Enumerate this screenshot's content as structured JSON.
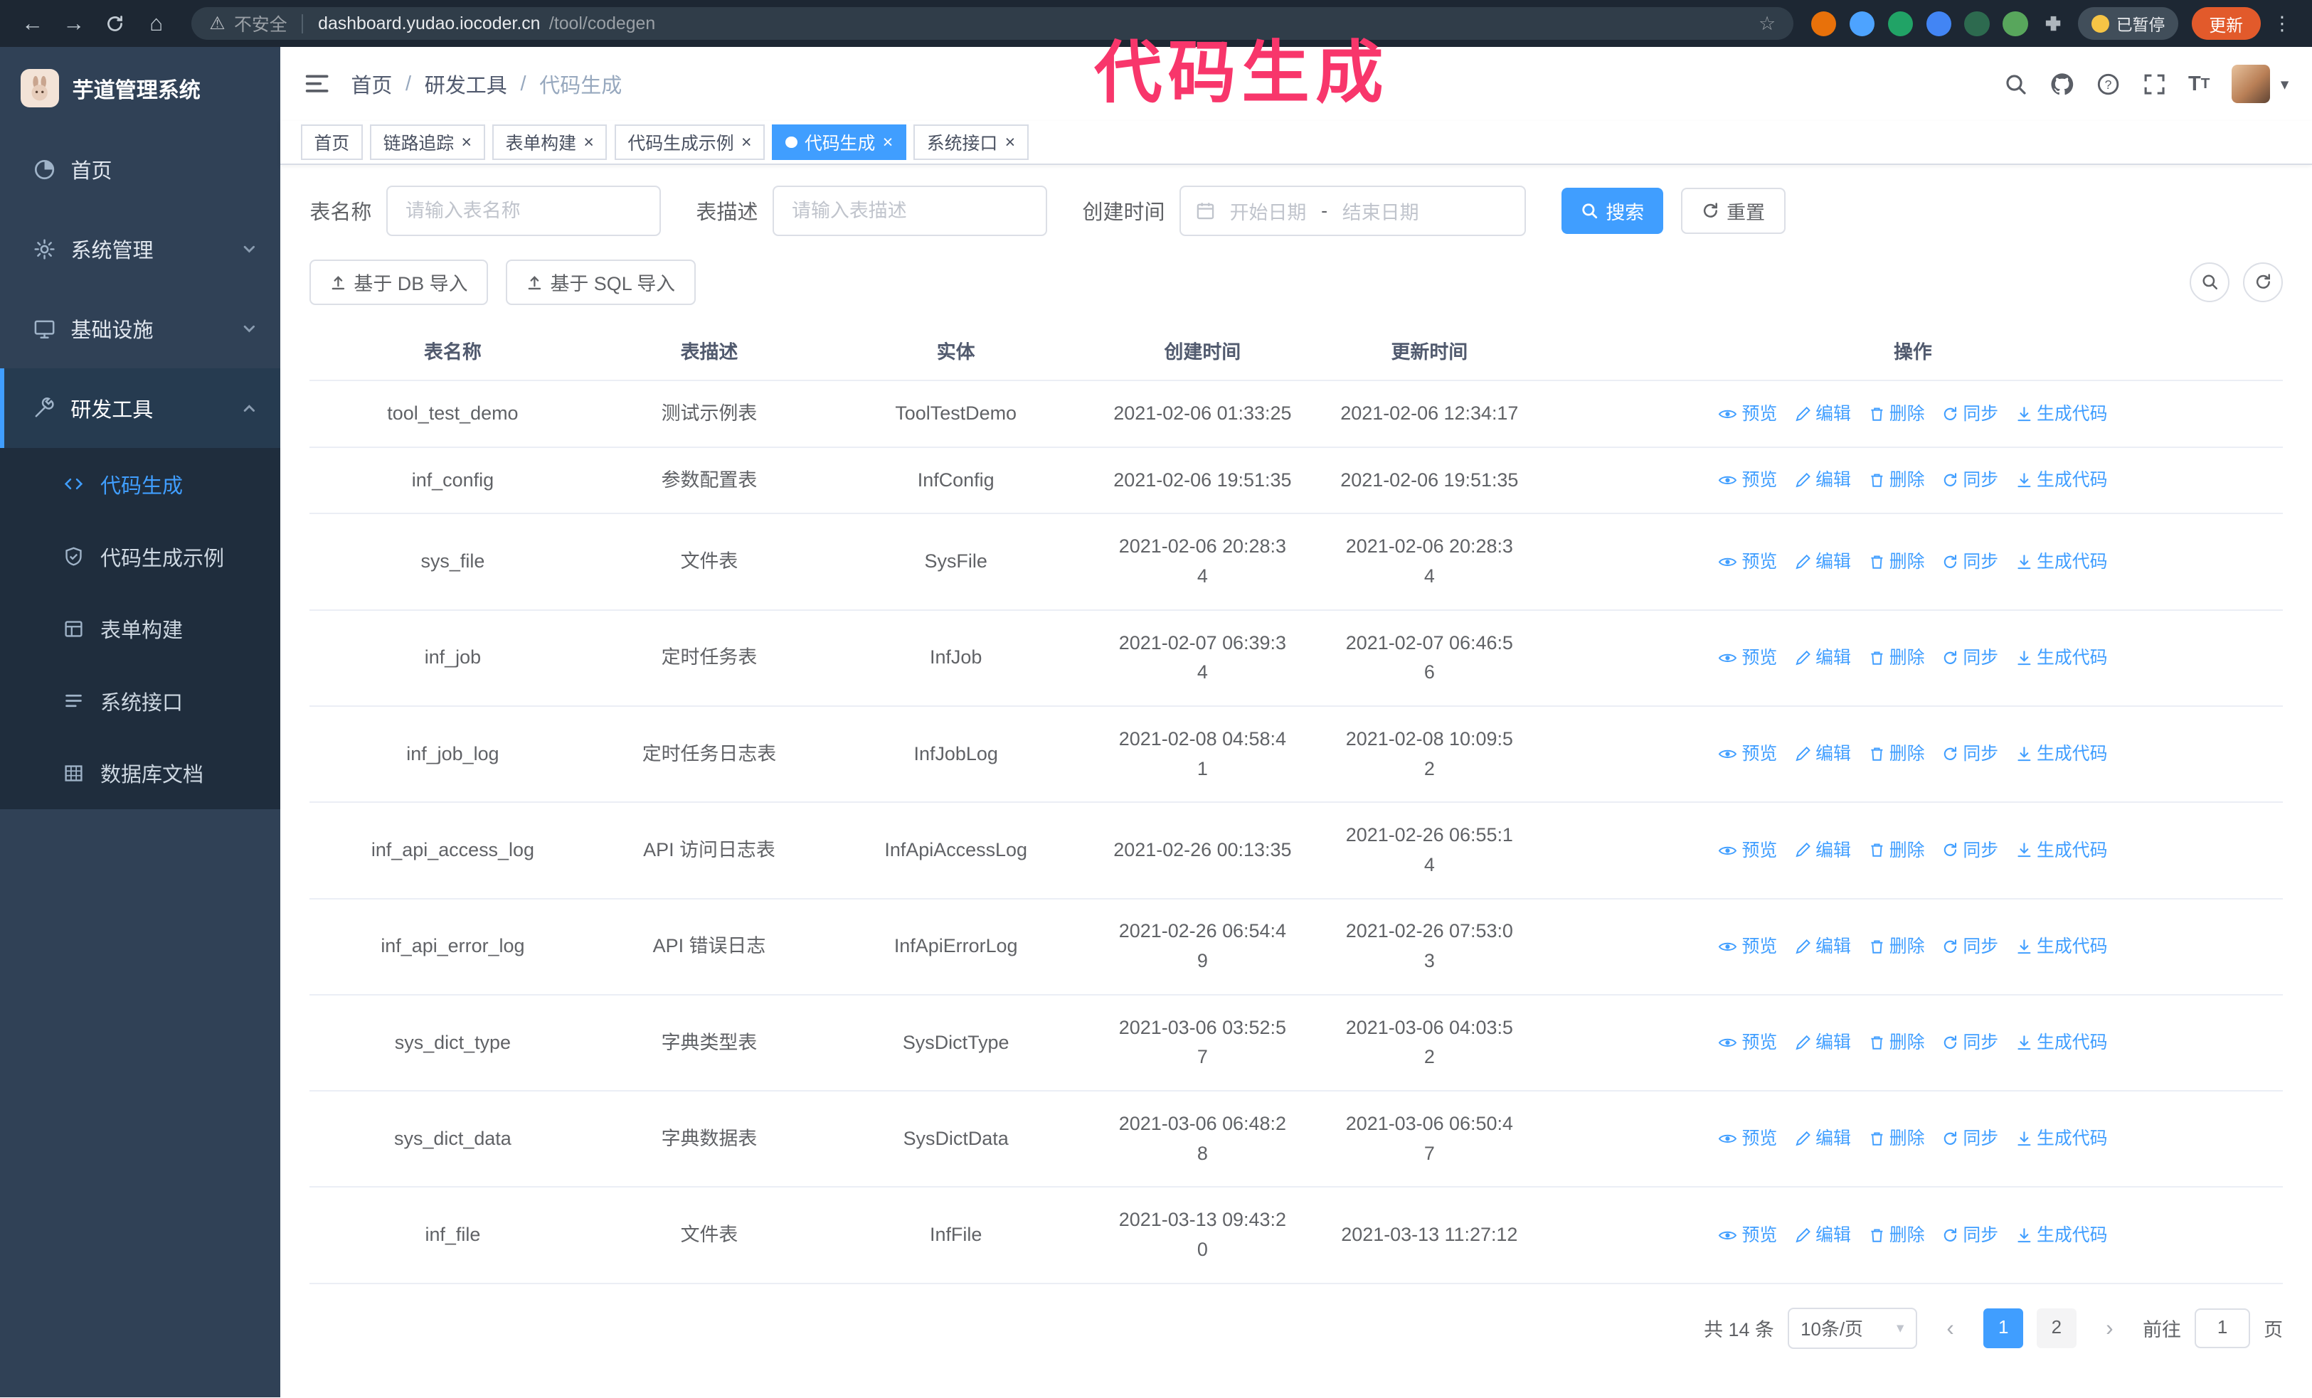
{
  "colors": {
    "accent": "#409EFF",
    "sidebar_bg": "#304156",
    "submenu_bg": "#1f2d3d",
    "annotation": "#f8366b",
    "chrome_bg": "#1d2733"
  },
  "browser": {
    "security_label": "不安全",
    "url_host": "dashboard.yudao.iocoder.cn",
    "url_path": "/tool/codegen",
    "paused_badge": "已暂停",
    "update_button": "更新",
    "nav_icons": [
      "back-icon",
      "forward-icon",
      "reload-icon",
      "home-icon"
    ],
    "extension_icons": [
      "extension-1-icon",
      "extension-2-icon",
      "extension-3-icon",
      "extension-4-icon",
      "extension-5-icon",
      "extension-6-icon",
      "extensions-puzzle-icon"
    ]
  },
  "annotation": {
    "text": "代码生成",
    "color": "#f8366b"
  },
  "sidebar": {
    "logo_title": "芋道管理系统",
    "items": [
      {
        "label": "首页",
        "icon": "dashboard",
        "expandable": false,
        "expanded": false
      },
      {
        "label": "系统管理",
        "icon": "gear",
        "expandable": true,
        "expanded": false
      },
      {
        "label": "基础设施",
        "icon": "monitor",
        "expandable": true,
        "expanded": false
      },
      {
        "label": "研发工具",
        "icon": "tools",
        "expandable": true,
        "expanded": true
      }
    ],
    "subitems": [
      {
        "label": "代码生成",
        "icon": "code",
        "active": true
      },
      {
        "label": "代码生成示例",
        "icon": "shield",
        "active": false
      },
      {
        "label": "表单构建",
        "icon": "form",
        "active": false
      },
      {
        "label": "系统接口",
        "icon": "api",
        "active": false
      },
      {
        "label": "数据库文档",
        "icon": "dbdoc",
        "active": false
      }
    ]
  },
  "navbar": {
    "breadcrumb": [
      "首页",
      "研发工具",
      "代码生成"
    ],
    "breadcrumb_separator": "/",
    "right_icons": [
      "search-icon",
      "github-icon",
      "help-icon",
      "fullscreen-icon",
      "font-size-icon",
      "avatar",
      "caret-down-icon"
    ]
  },
  "tabs": [
    {
      "label": "首页",
      "closable": false,
      "active": false
    },
    {
      "label": "链路追踪",
      "closable": true,
      "active": false
    },
    {
      "label": "表单构建",
      "closable": true,
      "active": false
    },
    {
      "label": "代码生成示例",
      "closable": true,
      "active": false
    },
    {
      "label": "代码生成",
      "closable": true,
      "active": true
    },
    {
      "label": "系统接口",
      "closable": true,
      "active": false
    }
  ],
  "filters": {
    "table_name_label": "表名称",
    "table_name_placeholder": "请输入表名称",
    "table_desc_label": "表描述",
    "table_desc_placeholder": "请输入表描述",
    "create_time_label": "创建时间",
    "date_start_placeholder": "开始日期",
    "date_separator": "-",
    "date_end_placeholder": "结束日期",
    "search_button": "搜索",
    "reset_button": "重置"
  },
  "toolbar": {
    "import_db_button": "基于 DB 导入",
    "import_sql_button": "基于 SQL 导入"
  },
  "table": {
    "columns": [
      "表名称",
      "表描述",
      "实体",
      "创建时间",
      "更新时间",
      "操作"
    ],
    "actions": [
      {
        "label": "预览",
        "icon": "preview"
      },
      {
        "label": "编辑",
        "icon": "edit"
      },
      {
        "label": "删除",
        "icon": "delete"
      },
      {
        "label": "同步",
        "icon": "sync"
      },
      {
        "label": "生成代码",
        "icon": "generate"
      }
    ],
    "rows": [
      {
        "name": "tool_test_demo",
        "desc": "测试示例表",
        "entity": "ToolTestDemo",
        "created": "2021-02-06 01:33:25",
        "updated": "2021-02-06 12:34:17"
      },
      {
        "name": "inf_config",
        "desc": "参数配置表",
        "entity": "InfConfig",
        "created": "2021-02-06 19:51:35",
        "updated": "2021-02-06 19:51:35"
      },
      {
        "name": "sys_file",
        "desc": "文件表",
        "entity": "SysFile",
        "created": "2021-02-06 20:28:3\n4",
        "updated": "2021-02-06 20:28:3\n4"
      },
      {
        "name": "inf_job",
        "desc": "定时任务表",
        "entity": "InfJob",
        "created": "2021-02-07 06:39:3\n4",
        "updated": "2021-02-07 06:46:5\n6"
      },
      {
        "name": "inf_job_log",
        "desc": "定时任务日志表",
        "entity": "InfJobLog",
        "created": "2021-02-08 04:58:4\n1",
        "updated": "2021-02-08 10:09:5\n2"
      },
      {
        "name": "inf_api_access_log",
        "desc": "API 访问日志表",
        "entity": "InfApiAccessLog",
        "created": "2021-02-26 00:13:35",
        "updated": "2021-02-26 06:55:1\n4"
      },
      {
        "name": "inf_api_error_log",
        "desc": "API 错误日志",
        "entity": "InfApiErrorLog",
        "created": "2021-02-26 06:54:4\n9",
        "updated": "2021-02-26 07:53:0\n3"
      },
      {
        "name": "sys_dict_type",
        "desc": "字典类型表",
        "entity": "SysDictType",
        "created": "2021-03-06 03:52:5\n7",
        "updated": "2021-03-06 04:03:5\n2"
      },
      {
        "name": "sys_dict_data",
        "desc": "字典数据表",
        "entity": "SysDictData",
        "created": "2021-03-06 06:48:2\n8",
        "updated": "2021-03-06 06:50:4\n7"
      },
      {
        "name": "inf_file",
        "desc": "文件表",
        "entity": "InfFile",
        "created": "2021-03-13 09:43:2\n0",
        "updated": "2021-03-13 11:27:12"
      }
    ]
  },
  "pagination": {
    "total_text": "共 14 条",
    "page_size": "10条/页",
    "pages": [
      "1",
      "2"
    ],
    "current_page": "1",
    "goto_label": "前往",
    "goto_value": "1",
    "page_unit": "页"
  }
}
